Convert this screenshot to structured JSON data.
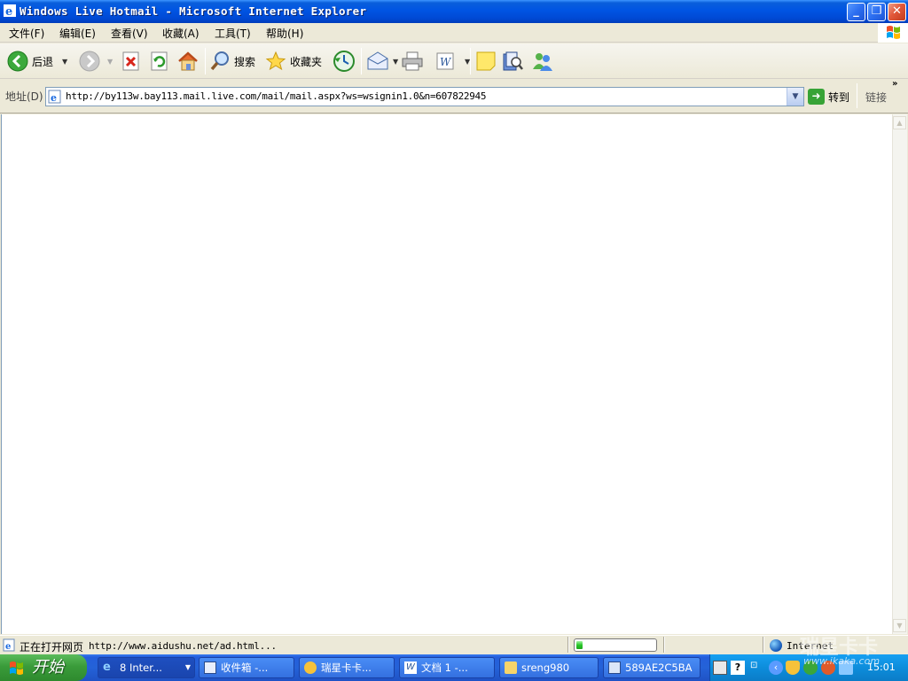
{
  "window": {
    "title": "Windows Live Hotmail - Microsoft Internet Explorer"
  },
  "menu": [
    "文件(F)",
    "编辑(E)",
    "查看(V)",
    "收藏(A)",
    "工具(T)",
    "帮助(H)"
  ],
  "toolbar": {
    "back_label": "后退",
    "search_label": "搜索",
    "favorites_label": "收藏夹"
  },
  "address": {
    "label": "地址(D)",
    "url": "http://by113w.bay113.mail.live.com/mail/mail.aspx?ws=wsignin1.0&n=607822945",
    "go_label": "转到",
    "links_label": "链接"
  },
  "status": {
    "text": "正在打开网页",
    "url": "http://www.aidushu.net/ad.html...",
    "progress": 0.08,
    "zone": "Internet"
  },
  "taskbar": {
    "start_label": "开始",
    "tasks": [
      {
        "label": "8 Inter...",
        "active": true
      },
      {
        "label": "收件箱 -..."
      },
      {
        "label": "瑞星卡卡..."
      },
      {
        "label": "文档 1 -..."
      },
      {
        "label": "sreng980"
      },
      {
        "label": "589AE2C5BA"
      }
    ],
    "clock": "15:01"
  },
  "watermark": {
    "text": "瑞星卡卡",
    "url": "www.ikaka.com"
  },
  "colors": {
    "titlebar": "#0054e3",
    "taskbar": "#245edb",
    "start_green": "#3a9b3a",
    "tray": "#0d8ddb",
    "progress": "#29c629"
  }
}
